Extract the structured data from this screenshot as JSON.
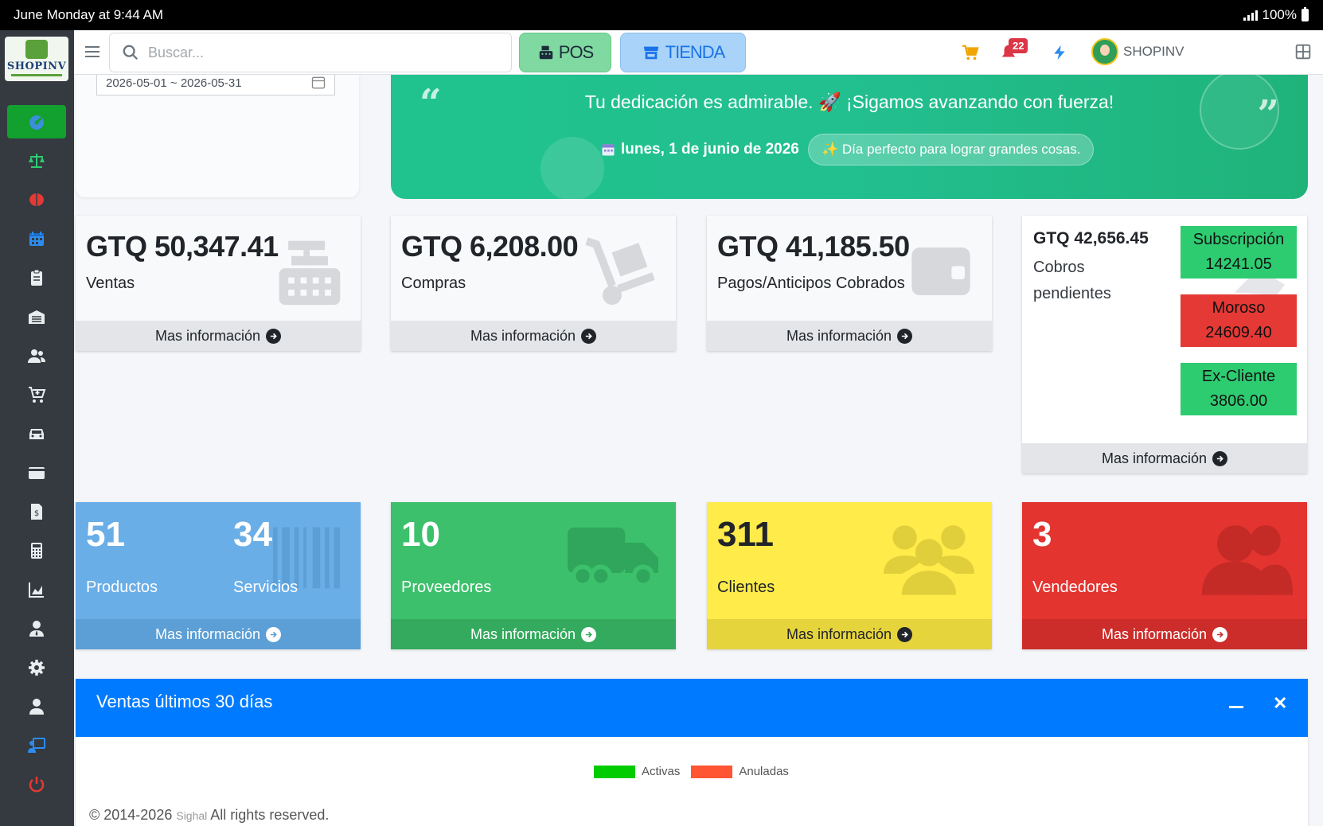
{
  "status_bar": {
    "time": "June Monday at 9:44 AM",
    "battery": "100%"
  },
  "sidebar": {
    "logo_text": "SHOPINV",
    "items": [
      {
        "name": "dashboard",
        "icon": "gauge-icon",
        "active": true
      },
      {
        "name": "balance",
        "icon": "scale-icon"
      },
      {
        "name": "brain",
        "icon": "brain-icon"
      },
      {
        "name": "calendar",
        "icon": "calendar-icon"
      },
      {
        "name": "clipboard",
        "icon": "clipboard-icon"
      },
      {
        "name": "warehouse",
        "icon": "warehouse-icon"
      },
      {
        "name": "users",
        "icon": "users-icon"
      },
      {
        "name": "cart",
        "icon": "cart-plus-icon"
      },
      {
        "name": "vehicle",
        "icon": "car-icon"
      },
      {
        "name": "wallet",
        "icon": "wallet-icon"
      },
      {
        "name": "invoice",
        "icon": "invoice-icon"
      },
      {
        "name": "calculator",
        "icon": "calculator-icon"
      },
      {
        "name": "reports",
        "icon": "chart-area-icon"
      },
      {
        "name": "employee",
        "icon": "user-tie-icon"
      },
      {
        "name": "settings",
        "icon": "gear-icon"
      },
      {
        "name": "profile",
        "icon": "user-icon"
      },
      {
        "name": "teacher",
        "icon": "presentation-icon"
      },
      {
        "name": "logout",
        "icon": "power-icon"
      }
    ]
  },
  "topbar": {
    "search_placeholder": "Buscar...",
    "pos_label": "POS",
    "tienda_label": "TIENDA",
    "notifications_count": "22",
    "user_name": "SHOPINV"
  },
  "date_range": "2026-05-01 ~ 2026-05-31",
  "banner": {
    "message": "Tu dedicación es admirable. 🚀 ¡Sigamos avanzando con fuerza!",
    "date": "lunes, 1 de junio de 2026",
    "tip": "✨ Día perfecto para lograr grandes cosas."
  },
  "stats": {
    "ventas": {
      "value": "GTQ 50,347.41",
      "label": "Ventas",
      "link": "Mas información"
    },
    "compras": {
      "value": "GTQ 6,208.00",
      "label": "Compras",
      "link": "Mas información"
    },
    "pagos": {
      "value": "GTQ 41,185.50",
      "label": "Pagos/Anticipos Cobrados",
      "link": "Mas información"
    },
    "cobros": {
      "value": "GTQ 42,656.45",
      "label_line1": "Cobros",
      "label_line2": "pendientes",
      "link": "Mas información",
      "subscripcion": {
        "label": "Subscripción",
        "value": "14241.05"
      },
      "moroso": {
        "label": "Moroso",
        "value": "24609.40"
      },
      "excliente": {
        "label": "Ex-Cliente",
        "value": "3806.00"
      }
    }
  },
  "counters": {
    "productos": {
      "value": "51",
      "label": "Productos"
    },
    "servicios": {
      "value": "34",
      "label": "Servicios"
    },
    "proveedores": {
      "value": "10",
      "label": "Proveedores"
    },
    "clientes": {
      "value": "311",
      "label": "Clientes"
    },
    "vendedores": {
      "value": "3",
      "label": "Vendedores"
    },
    "link": "Mas información"
  },
  "colors": {
    "blue": "#6aaee8",
    "blue_footer": "#5b9fd6",
    "green": "#3cc06b",
    "green_footer": "#33aa5d",
    "yellow": "#ffeb4a",
    "yellow_footer": "#e6d43c",
    "red": "#e3342f",
    "red_footer": "#cc2d2a"
  },
  "chart_data": {
    "type": "bar",
    "title": "Ventas últimos 30 días",
    "series": [
      {
        "name": "Activas",
        "color": "#00cc00"
      },
      {
        "name": "Anuladas",
        "color": "#ff5533"
      }
    ],
    "y_ticks": [
      "8000"
    ],
    "ylim": [
      0,
      8000
    ],
    "legend": "top-center"
  },
  "footer": {
    "copyright": "© 2014-2026",
    "brand": "Sighal",
    "rights": "All rights reserved."
  }
}
